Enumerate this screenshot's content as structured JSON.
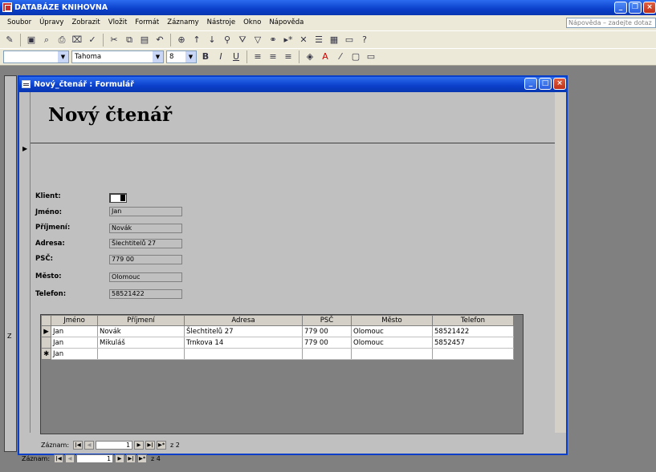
{
  "app": {
    "title": "DATABÁZE KNIHOVNA",
    "help_placeholder": "Nápověda – zadejte dotaz"
  },
  "menu": [
    "Soubor",
    "Úpravy",
    "Zobrazit",
    "Vložit",
    "Formát",
    "Záznamy",
    "Nástroje",
    "Okno",
    "Nápověda"
  ],
  "format_toolbar": {
    "font": "Tahoma",
    "size": "8"
  },
  "form": {
    "title": "Nový_čtenář : Formulář",
    "heading": "Nový čtenář",
    "fields": [
      {
        "label": "Klient:",
        "value": ""
      },
      {
        "label": "Jméno:",
        "value": "Jan"
      },
      {
        "label": "Příjmení:",
        "value": "Novák"
      },
      {
        "label": "Adresa:",
        "value": "Šlechtitelů 27"
      },
      {
        "label": "PSČ:",
        "value": "779 00"
      },
      {
        "label": "Město:",
        "value": "Olomouc"
      },
      {
        "label": "Telefon:",
        "value": "58521422"
      }
    ]
  },
  "grid": {
    "headers": [
      "Jméno",
      "Příjmení",
      "Adresa",
      "PSČ",
      "Město",
      "Telefon"
    ],
    "rows": [
      [
        "Jan",
        "Novák",
        "Šlechtitelů 27",
        "779 00",
        "Olomouc",
        "58521422"
      ],
      [
        "Jan",
        "Mikuláš",
        "Trnkova 14",
        "779 00",
        "Olomouc",
        "5852457"
      ]
    ],
    "new_row": [
      "Jan",
      "",
      "",
      "",
      "",
      ""
    ]
  },
  "sub_nav": {
    "label": "Záznam:",
    "current": "1",
    "total": "z 2"
  },
  "main_nav": {
    "label": "Záznam:",
    "current": "1",
    "total": "z 4"
  },
  "left_strip_char": "Z"
}
